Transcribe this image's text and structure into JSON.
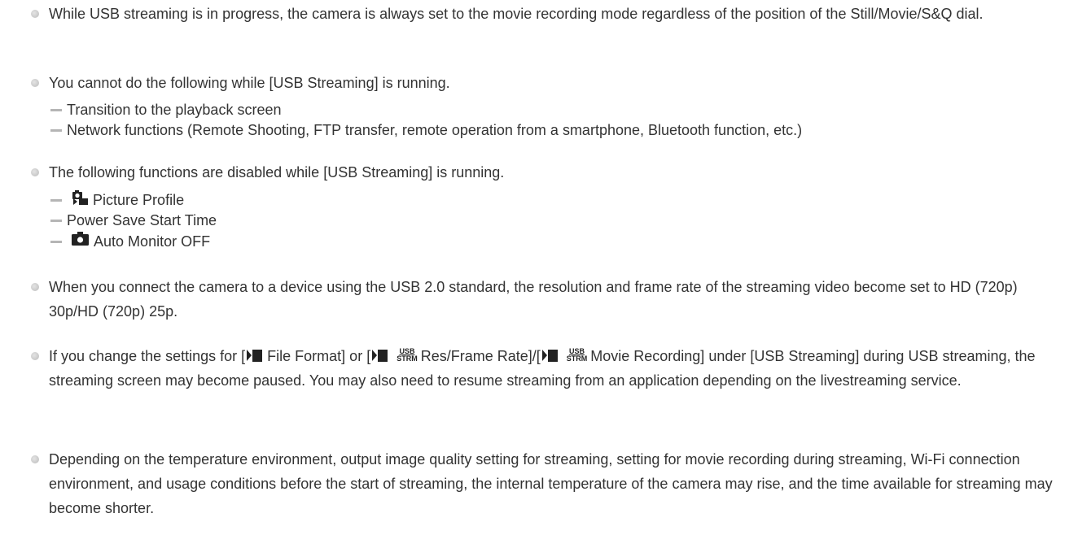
{
  "notes": [
    {
      "text": "While USB streaming is in progress, the camera is always set to the movie recording mode regardless of the position of the Still/Movie/S&Q dial."
    },
    {
      "text": "You cannot do the following while [USB Streaming] is running.",
      "sub_items": [
        {
          "label": "Transition to the playback screen"
        },
        {
          "label": "Network functions (Remote Shooting, FTP transfer, remote operation from a smartphone, Bluetooth function, etc.)"
        }
      ]
    },
    {
      "text": "The following functions are disabled while [USB Streaming] is running.",
      "sub_items": [
        {
          "icon": "picture-profile-icon",
          "label": "Picture Profile"
        },
        {
          "label": "Power Save Start Time"
        },
        {
          "icon": "camera-icon",
          "label": "Auto Monitor OFF"
        }
      ]
    },
    {
      "text": "When you connect the camera to a device using the USB 2.0 standard, the resolution and frame rate of the streaming video become set to HD (720p) 30p/HD (720p) 25p."
    },
    {
      "text_parts": {
        "p1": "If you change the settings for [",
        "p2": "File Format] or [",
        "p3": "Res/Frame Rate]/[",
        "p4": "Movie Recording] under [USB Streaming] during USB streaming, the streaming screen may become paused. You may also need to resume streaming from an application depending on the livestreaming service."
      },
      "icon_label": {
        "top": "USB",
        "bottom": "STRM"
      }
    },
    {
      "text": "Depending on the temperature environment, output image quality setting for streaming, setting for movie recording during streaming, Wi-Fi connection environment, and usage conditions before the start of streaming, the internal temperature of the camera may rise, and the time available for streaming may become shorter."
    }
  ],
  "colors": {
    "text": "#333333",
    "bullet": "#c7c7c7",
    "dash": "#b5b5b5",
    "icon": "#222222"
  }
}
